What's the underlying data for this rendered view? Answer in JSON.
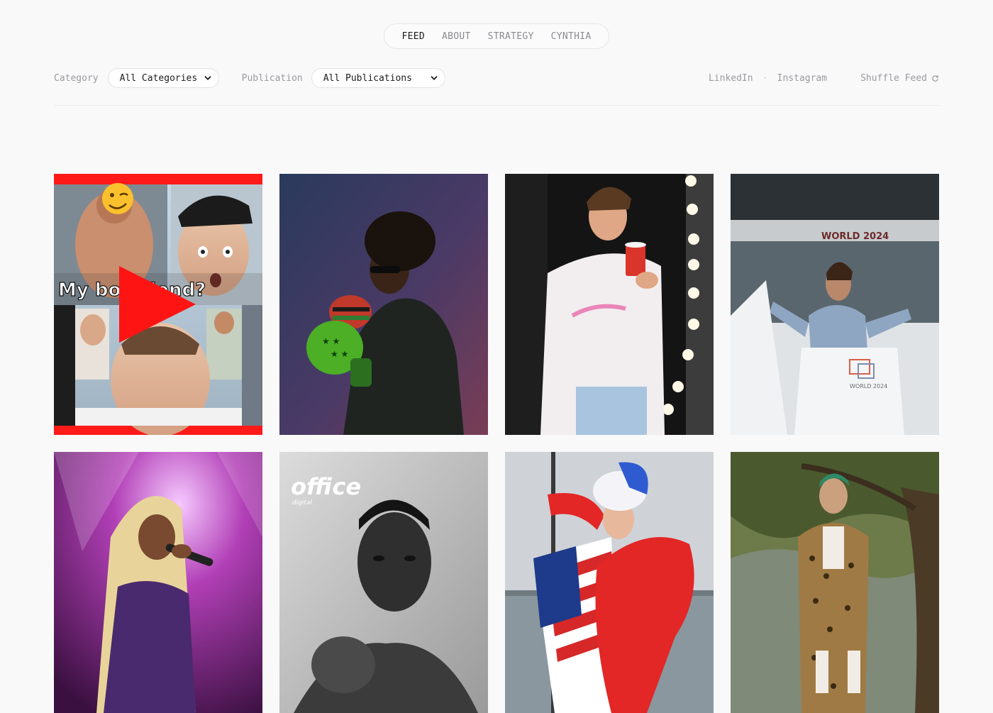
{
  "nav": {
    "items": [
      {
        "label": "FEED",
        "active": true
      },
      {
        "label": "ABOUT",
        "active": false
      },
      {
        "label": "STRATEGY",
        "active": false
      },
      {
        "label": "CYNTHIA",
        "active": false
      }
    ]
  },
  "filters": {
    "category_label": "Category",
    "category_value": "All Categories",
    "publication_label": "Publication",
    "publication_value": "All Publications"
  },
  "links": {
    "linkedin": "LinkedIn",
    "separator": "·",
    "instagram": "Instagram",
    "shuffle": "Shuffle Feed"
  },
  "icons": {
    "select_arrow": "chevron-down-icon",
    "shuffle": "refresh-icon",
    "play": "play-icon"
  },
  "feed": [
    {
      "image": "youtube-thumbnail-collage",
      "caption_text": "My boyfriend?"
    },
    {
      "image": "boxing-glove-portrait"
    },
    {
      "image": "dressing-room-portrait"
    },
    {
      "image": "podium-speaker-photo",
      "banner_text": "WORLD 2024",
      "podium_text": "WORLD 2024"
    },
    {
      "image": "concert-singer-photo"
    },
    {
      "image": "office-magazine-portrait",
      "logo_text": "office",
      "logo_subtext": "digital"
    },
    {
      "image": "drag-performer-flag-photo"
    },
    {
      "image": "leopard-suit-tree-photo"
    }
  ],
  "colors": {
    "background": "#f9f9fa",
    "text_active": "#1d1d1f",
    "text_muted": "#9a9a9f",
    "youtube_red": "#ff1a1a"
  }
}
